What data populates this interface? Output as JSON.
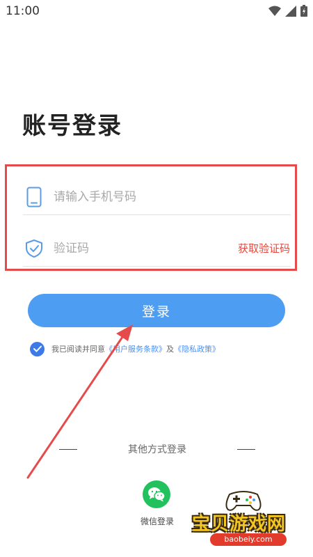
{
  "status_bar": {
    "time": "11:00",
    "icons": [
      "wifi-icon",
      "signal-icon",
      "battery-icon"
    ]
  },
  "login": {
    "title": "账号登录",
    "phone_placeholder": "请输入手机号码",
    "code_placeholder": "验证码",
    "get_code_label": "获取验证码",
    "login_button_label": "登录"
  },
  "agreement": {
    "prefix": "我已阅读并同意",
    "terms_link": "《用户服务条款》",
    "connector": "及",
    "privacy_link": "《隐私政策》"
  },
  "other_login": {
    "title": "其他方式登录",
    "wechat_label": "微信登录"
  },
  "watermark": {
    "site_name": "宝贝游戏网",
    "url": "baobeiy.com"
  },
  "colors": {
    "primary": "#4d9ef3",
    "accent_red": "#e5473f",
    "wechat_green": "#22c15e",
    "check_blue": "#3d7ae8"
  }
}
